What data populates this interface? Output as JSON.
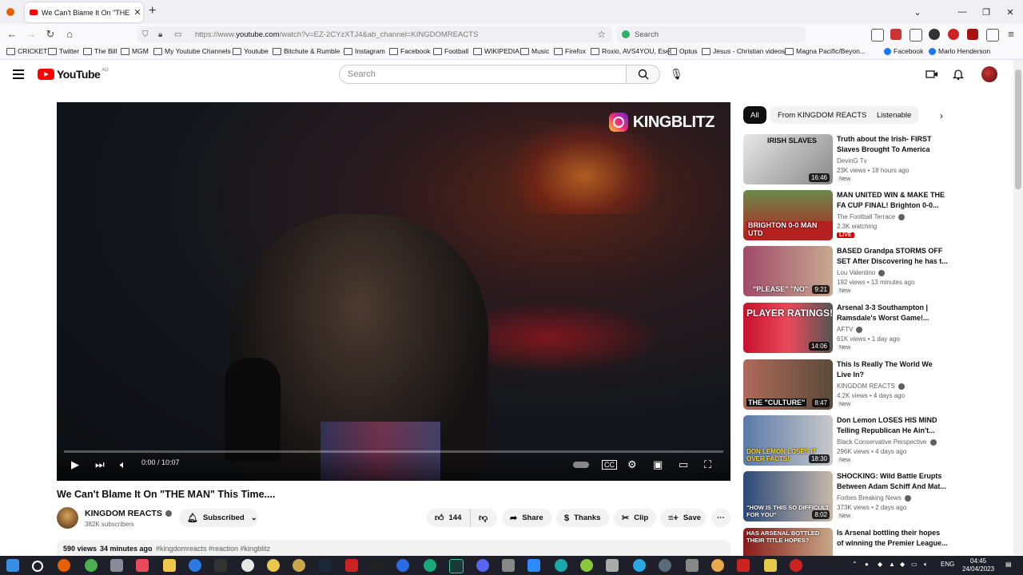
{
  "browser": {
    "tab_title": "We Can't Blame It On \"THE MAN\"",
    "url_prefix": "https://www.",
    "url_domain": "youtube.com",
    "url_rest": "/watch?v=EZ-2CYzXTJ4&ab_channel=KINGDOMREACTS",
    "search_placeholder": "Search",
    "bookmarks": [
      "CRICKET",
      "Twitter",
      "The Bill",
      "MGM",
      "My Youtube Channels",
      "Youtube",
      "Bitchute & Rumble",
      "Instagram",
      "Facebook",
      "Football",
      "WIKIPEDIA",
      "Music",
      "Firefox",
      "Roxio, AVS4YOU, Eset",
      "Optus",
      "Jesus - Christian videos",
      "Magna Pacific/Beyon...",
      "Facebook",
      "Marlo Henderson"
    ]
  },
  "youtube": {
    "logo_text": "YouTube",
    "country_code": "AU",
    "search_placeholder": "Search",
    "watermark": "KINGBLITZ",
    "time": "0:00 / 10:07",
    "video_title": "We Can't Blame It On \"THE MAN\" This Time....",
    "channel_name": "KINGDOM REACTS",
    "subscribers": "382K subscribers",
    "subscribed_label": "Subscribed",
    "like_count": "144",
    "share_label": "Share",
    "thanks_label": "Thanks",
    "clip_label": "Clip",
    "save_label": "Save",
    "desc_views": "590 views",
    "desc_time": "34 minutes ago",
    "desc_tags": "#kingdomreacts #reaction #kingblitz",
    "chips": [
      "All",
      "From KINGDOM REACTS",
      "Listenable"
    ],
    "related": [
      {
        "title": "Truth about the Irish- FIRST Slaves Brought To America",
        "channel": "DevinG Tv",
        "meta": "23K views • 18 hours ago",
        "badge": "New",
        "duration": "16:46",
        "caption": "IRISH SLAVES",
        "color": "#d9d9d9"
      },
      {
        "title": "MAN UNITED WIN & MAKE THE FA CUP FINAL! Brighton 0-0...",
        "channel": "The Football Terrace",
        "meta": "2.3K watching",
        "badge": "LIVE",
        "duration": "",
        "caption": "BRIGHTON 0-0 MAN UTD",
        "color": "#b52020"
      },
      {
        "title": "BASED Grandpa STORMS OFF SET After Discovering he has t...",
        "channel": "Lou Valentino",
        "meta": "192 views • 13 minutes ago",
        "badge": "New",
        "duration": "9:21",
        "caption": "\"PLEASE\" \"NO\"",
        "color": "#8a3a5a"
      },
      {
        "title": "Arsenal 3-3 Southampton | Ramsdale's Worst Game!...",
        "channel": "AFTV",
        "meta": "61K views • 1 day ago",
        "badge": "New",
        "duration": "14:06",
        "caption": "PLAYER RATINGS!",
        "color": "#c8102e"
      },
      {
        "title": "This Is Really The World We Live In?",
        "channel": "KINGDOM REACTS",
        "meta": "4.2K views • 4 days ago",
        "badge": "New",
        "duration": "8:47",
        "caption": "THE \"CULTURE\"",
        "color": "#7a5a4a"
      },
      {
        "title": "Don Lemon LOSES HIS MIND Telling Republican He Ain't...",
        "channel": "Black Conservative Perspective",
        "meta": "296K views • 4 days ago",
        "badge": "New",
        "duration": "18:30",
        "caption": "DON LEMON LOSES IT OVER FACTS!",
        "color": "#3a5a8a"
      },
      {
        "title": "SHOCKING: Wild Battle Erupts Between Adam Schiff And Mat...",
        "channel": "Forbes Breaking News",
        "meta": "373K views • 2 days ago",
        "badge": "New",
        "duration": "8:02",
        "caption": "\"HOW IS THIS SO DIFFICULT FOR YOU\"",
        "color": "#2a4a7a"
      },
      {
        "title": "Is Arsenal bottling their hopes of winning the Premier League...",
        "channel": "",
        "meta": "",
        "badge": "",
        "duration": "",
        "caption": "HAS ARSENAL BOTTLED THEIR TITLE HOPES?",
        "color": "#8a1a1a"
      }
    ]
  },
  "taskbar": {
    "lang": "ENG",
    "time": "04:45",
    "date": "24/04/2023"
  }
}
